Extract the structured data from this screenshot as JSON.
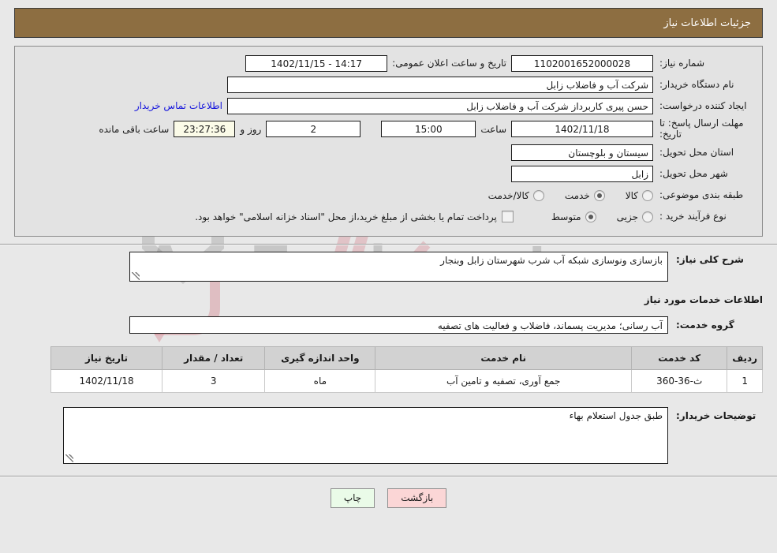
{
  "header": {
    "title": "جزئیات اطلاعات نیاز"
  },
  "form": {
    "need_number_label": "شماره نیاز:",
    "need_number_value": "1102001652000028",
    "announce_label": "تاریخ و ساعت اعلان عمومی:",
    "announce_value": "14:17 - 1402/11/15",
    "buyer_org_label": "نام دستگاه خریدار:",
    "buyer_org_value": "شرکت آب و فاضلاب زابل",
    "creator_label": "ایجاد کننده درخواست:",
    "creator_value": "حسن پیری کاربرداز شرکت آب و فاضلاب زابل",
    "contact_link": "اطلاعات تماس خریدار",
    "deadline_label": "مهلت ارسال پاسخ: تا تاریخ:",
    "deadline_date": "1402/11/18",
    "hour_label": "ساعت",
    "deadline_time": "15:00",
    "days_value": "2",
    "days_label": "روز و",
    "countdown_value": "23:27:36",
    "remaining_label": "ساعت باقی مانده",
    "province_label": "استان محل تحویل:",
    "province_value": "سیستان و بلوچستان",
    "city_label": "شهر محل تحویل:",
    "city_value": "زابل",
    "category_label": "طبقه بندی موضوعی:",
    "category_options": [
      {
        "label": "کالا",
        "selected": false
      },
      {
        "label": "خدمت",
        "selected": true
      },
      {
        "label": "کالا/خدمت",
        "selected": false
      }
    ],
    "process_label": "نوع فرآیند خرید :",
    "process_options": [
      {
        "label": "جزیی",
        "selected": false
      },
      {
        "label": "متوسط",
        "selected": true
      }
    ],
    "treasury_checkbox_text": "پرداخت تمام یا بخشی از مبلغ خرید،از محل \"اسناد خزانه اسلامی\" خواهد بود.",
    "treasury_checked": false
  },
  "need_description": {
    "label": "شرح کلی نیاز:",
    "value": "بازسازی ونوسازی شبکه آب شرب شهرستان زابل وبنجار"
  },
  "services_section": {
    "heading": "اطلاعات خدمات مورد نیاز",
    "service_group_label": "گروه خدمت:",
    "service_group_value": "آب رسانی؛ مدیریت پسماند، فاضلاب و فعالیت های تصفیه"
  },
  "items_table": {
    "columns": [
      "ردیف",
      "کد خدمت",
      "نام خدمت",
      "واحد اندازه گیری",
      "تعداد / مقدار",
      "تاریخ نیاز"
    ],
    "rows": [
      {
        "radif": "1",
        "code": "ث-36-360",
        "name": "جمع آوری، تصفیه و تامین آب",
        "unit": "ماه",
        "qty": "3",
        "date": "1402/11/18"
      }
    ]
  },
  "buyer_notes": {
    "label": "توضیحات خریدار:",
    "value": "طبق جدول استعلام بهاء"
  },
  "footer": {
    "back_button": "بازگشت",
    "print_button": "چاپ"
  },
  "watermark": {
    "text": "AnaTender.net"
  },
  "colors": {
    "header_brown": "#8d6e41",
    "link_blue": "#1414dd",
    "timer_bg": "#fbfbe8",
    "back_btn": "#fbd6d6",
    "print_btn": "#eafbe8"
  }
}
